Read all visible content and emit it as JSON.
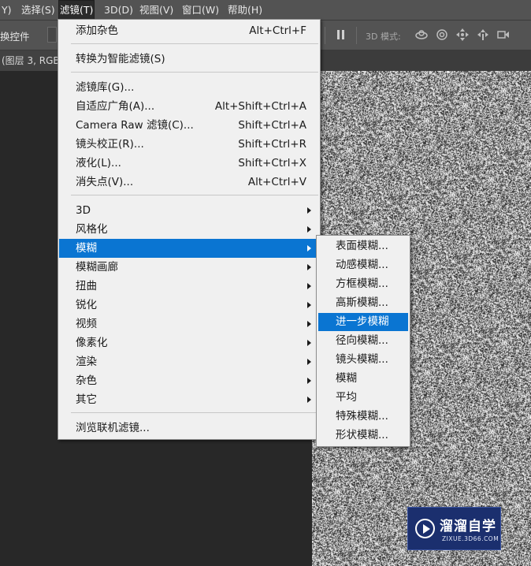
{
  "menubar": {
    "items": [
      "Y)",
      "选择(S)",
      "滤镜(T)",
      "3D(D)",
      "视图(V)",
      "窗口(W)",
      "帮助(H)"
    ]
  },
  "options_bar": {
    "left_label": "换控件",
    "mode_3d_label": "3D 模式:"
  },
  "document_tab": {
    "title": "(图层 3, RGB"
  },
  "filter_menu": {
    "items": [
      {
        "label": "添加杂色",
        "shortcut": "Alt+Ctrl+F"
      },
      {
        "label": "转换为智能滤镜(S)",
        "shortcut": ""
      },
      {
        "label": "滤镜库(G)...",
        "shortcut": ""
      },
      {
        "label": "自适应广角(A)...",
        "shortcut": "Alt+Shift+Ctrl+A"
      },
      {
        "label": "Camera Raw 滤镜(C)...",
        "shortcut": "Shift+Ctrl+A"
      },
      {
        "label": "镜头校正(R)...",
        "shortcut": "Shift+Ctrl+R"
      },
      {
        "label": "液化(L)...",
        "shortcut": "Shift+Ctrl+X"
      },
      {
        "label": "消失点(V)...",
        "shortcut": "Alt+Ctrl+V"
      },
      {
        "label": "3D",
        "shortcut": ""
      },
      {
        "label": "风格化",
        "shortcut": ""
      },
      {
        "label": "模糊",
        "shortcut": ""
      },
      {
        "label": "模糊画廊",
        "shortcut": ""
      },
      {
        "label": "扭曲",
        "shortcut": ""
      },
      {
        "label": "锐化",
        "shortcut": ""
      },
      {
        "label": "视频",
        "shortcut": ""
      },
      {
        "label": "像素化",
        "shortcut": ""
      },
      {
        "label": "渲染",
        "shortcut": ""
      },
      {
        "label": "杂色",
        "shortcut": ""
      },
      {
        "label": "其它",
        "shortcut": ""
      },
      {
        "label": "浏览联机滤镜...",
        "shortcut": ""
      }
    ]
  },
  "blur_submenu": {
    "items": [
      "表面模糊...",
      "动感模糊...",
      "方框模糊...",
      "高斯模糊...",
      "进一步模糊",
      "径向模糊...",
      "镜头模糊...",
      "模糊",
      "平均",
      "特殊模糊...",
      "形状模糊..."
    ]
  },
  "watermark": {
    "title": "溜溜自学",
    "url": "ZIXUE.3D66.COM"
  },
  "colors": {
    "menu_highlight": "#0a75d2",
    "menubar_bg": "#535353",
    "menu_bg": "#f0f0f0",
    "watermark_bg": "#1b2f6e"
  }
}
